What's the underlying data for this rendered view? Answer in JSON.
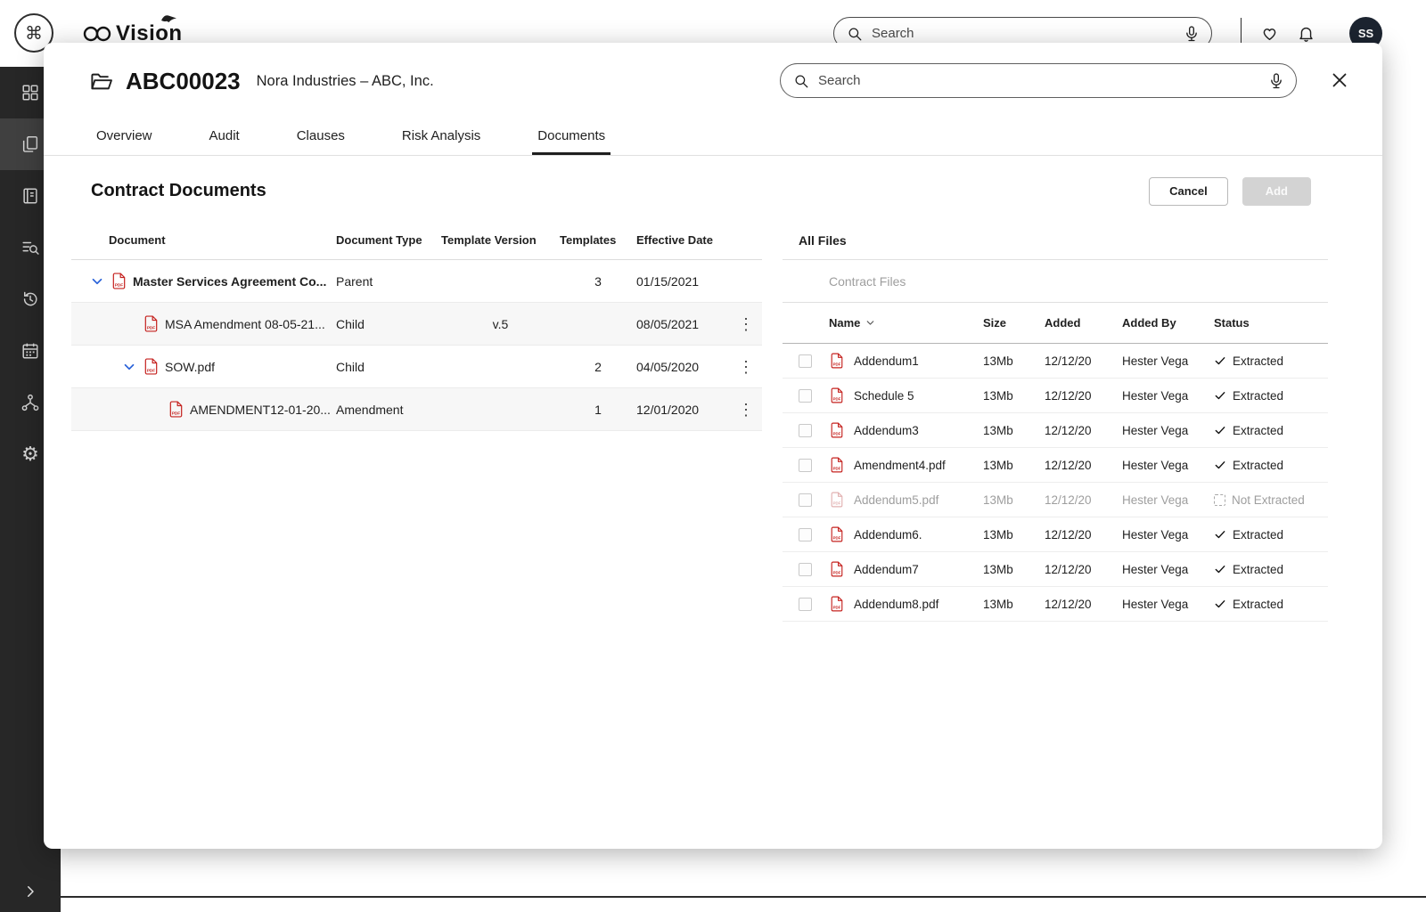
{
  "colors": {
    "accent_blue": "#2a62d9",
    "pdf_red": "#c5221f",
    "sidebar_bg": "#272727",
    "disabled_gray": "#9e9e9e"
  },
  "icons": {
    "kebab": "⋮",
    "gear": "⚙",
    "command": "⌘"
  },
  "topbar": {
    "logo_text": "Vision",
    "search_placeholder": "Search",
    "avatar_initials": "SS"
  },
  "modal": {
    "title": "ABC00023",
    "subtitle": "Nora Industries – ABC, Inc.",
    "search_placeholder": "Search",
    "tabs": [
      "Overview",
      "Audit",
      "Clauses",
      "Risk Analysis",
      "Documents"
    ],
    "active_tab": "Documents",
    "section_title": "Contract Documents",
    "buttons": {
      "cancel": "Cancel",
      "add": "Add"
    }
  },
  "documents_table": {
    "headers": {
      "document": "Document",
      "type": "Document Type",
      "template_version": "Template Version",
      "templates": "Templates",
      "effective_date": "Effective Date"
    },
    "rows": [
      {
        "name": "Master Services Agreement Co...",
        "type": "Parent",
        "template_version": "",
        "templates": "3",
        "effective_date": "01/15/2021"
      },
      {
        "name": "MSA Amendment 08-05-21...",
        "type": "Child",
        "template_version": "v.5",
        "templates": "",
        "effective_date": "08/05/2021"
      },
      {
        "name": "SOW.pdf",
        "type": "Child",
        "template_version": "",
        "templates": "2",
        "effective_date": "04/05/2020"
      },
      {
        "name": "AMENDMENT12-01-20...",
        "type": "Amendment",
        "template_version": "",
        "templates": "1",
        "effective_date": "12/01/2020"
      }
    ]
  },
  "files_panel": {
    "title": "All Files",
    "filter_placeholder": "Contract Files",
    "headers": {
      "name": "Name",
      "size": "Size",
      "added": "Added",
      "added_by": "Added By",
      "status": "Status"
    },
    "rows": [
      {
        "name": "Addendum1",
        "size": "13Mb",
        "added": "12/12/20",
        "added_by": "Hester Vega",
        "status": "Extracted"
      },
      {
        "name": "Schedule 5",
        "size": "13Mb",
        "added": "12/12/20",
        "added_by": "Hester Vega",
        "status": "Extracted"
      },
      {
        "name": "Addendum3",
        "size": "13Mb",
        "added": "12/12/20",
        "added_by": "Hester Vega",
        "status": "Extracted"
      },
      {
        "name": "Amendment4.pdf",
        "size": "13Mb",
        "added": "12/12/20",
        "added_by": "Hester Vega",
        "status": "Extracted"
      },
      {
        "name": "Addendum5.pdf",
        "size": "13Mb",
        "added": "12/12/20",
        "added_by": "Hester Vega",
        "status": "Not Extracted"
      },
      {
        "name": "Addendum6.",
        "size": "13Mb",
        "added": "12/12/20",
        "added_by": "Hester Vega",
        "status": "Extracted"
      },
      {
        "name": "Addendum7",
        "size": "13Mb",
        "added": "12/12/20",
        "added_by": "Hester Vega",
        "status": "Extracted"
      },
      {
        "name": "Addendum8.pdf",
        "size": "13Mb",
        "added": "12/12/20",
        "added_by": "Hester Vega",
        "status": "Extracted"
      }
    ]
  },
  "sidebar": {
    "items": [
      "dashboard",
      "documents",
      "journal",
      "search",
      "history",
      "calendar",
      "network",
      "settings"
    ],
    "active": "documents"
  }
}
